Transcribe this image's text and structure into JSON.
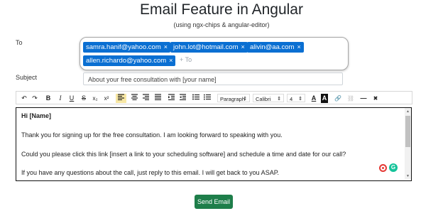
{
  "header": {
    "title": "Email Feature in Angular",
    "subtitle": "(using ngx-chips & angular-editor)"
  },
  "form": {
    "to_label": "To",
    "recipients": [
      "samra.hanif@yahoo.com",
      "john.lot@hotmail.com",
      "alivin@aa.com",
      "allen.richardo@yahoo.com"
    ],
    "chip_remove_icon": "×",
    "add_placeholder": "+ To",
    "subject_label": "Subject",
    "subject_value": "About your free consultation with [your name]"
  },
  "toolbar": {
    "undo": "↶",
    "redo": "↷",
    "bold": "B",
    "italic": "I",
    "underline": "U",
    "strike": "S",
    "subscript": "x₂",
    "superscript": "x²",
    "paragraph": "Paragraph",
    "font": "Calibri",
    "size": "4",
    "select_arrow": "⇕",
    "text_color": "A",
    "background_color": "A",
    "link": "🔗",
    "unlink": "⛓",
    "hr": "—",
    "clear": "✖"
  },
  "editor": {
    "greeting": "Hi [Name]",
    "line1": "Thank you for signing up for the free consultation. I am looking forward to speaking with you.",
    "line2": "Could you please click this link [insert a link to your scheduling software] and schedule a time and date for our call?",
    "line3": "If you have any questions about the call, just reply to this email. I will get back to you ASAP."
  },
  "send_button": "Send Email",
  "colors": {
    "chip": "#0a6fd2",
    "send": "#1e7e4a",
    "active_tool": "#f7e7a4"
  }
}
